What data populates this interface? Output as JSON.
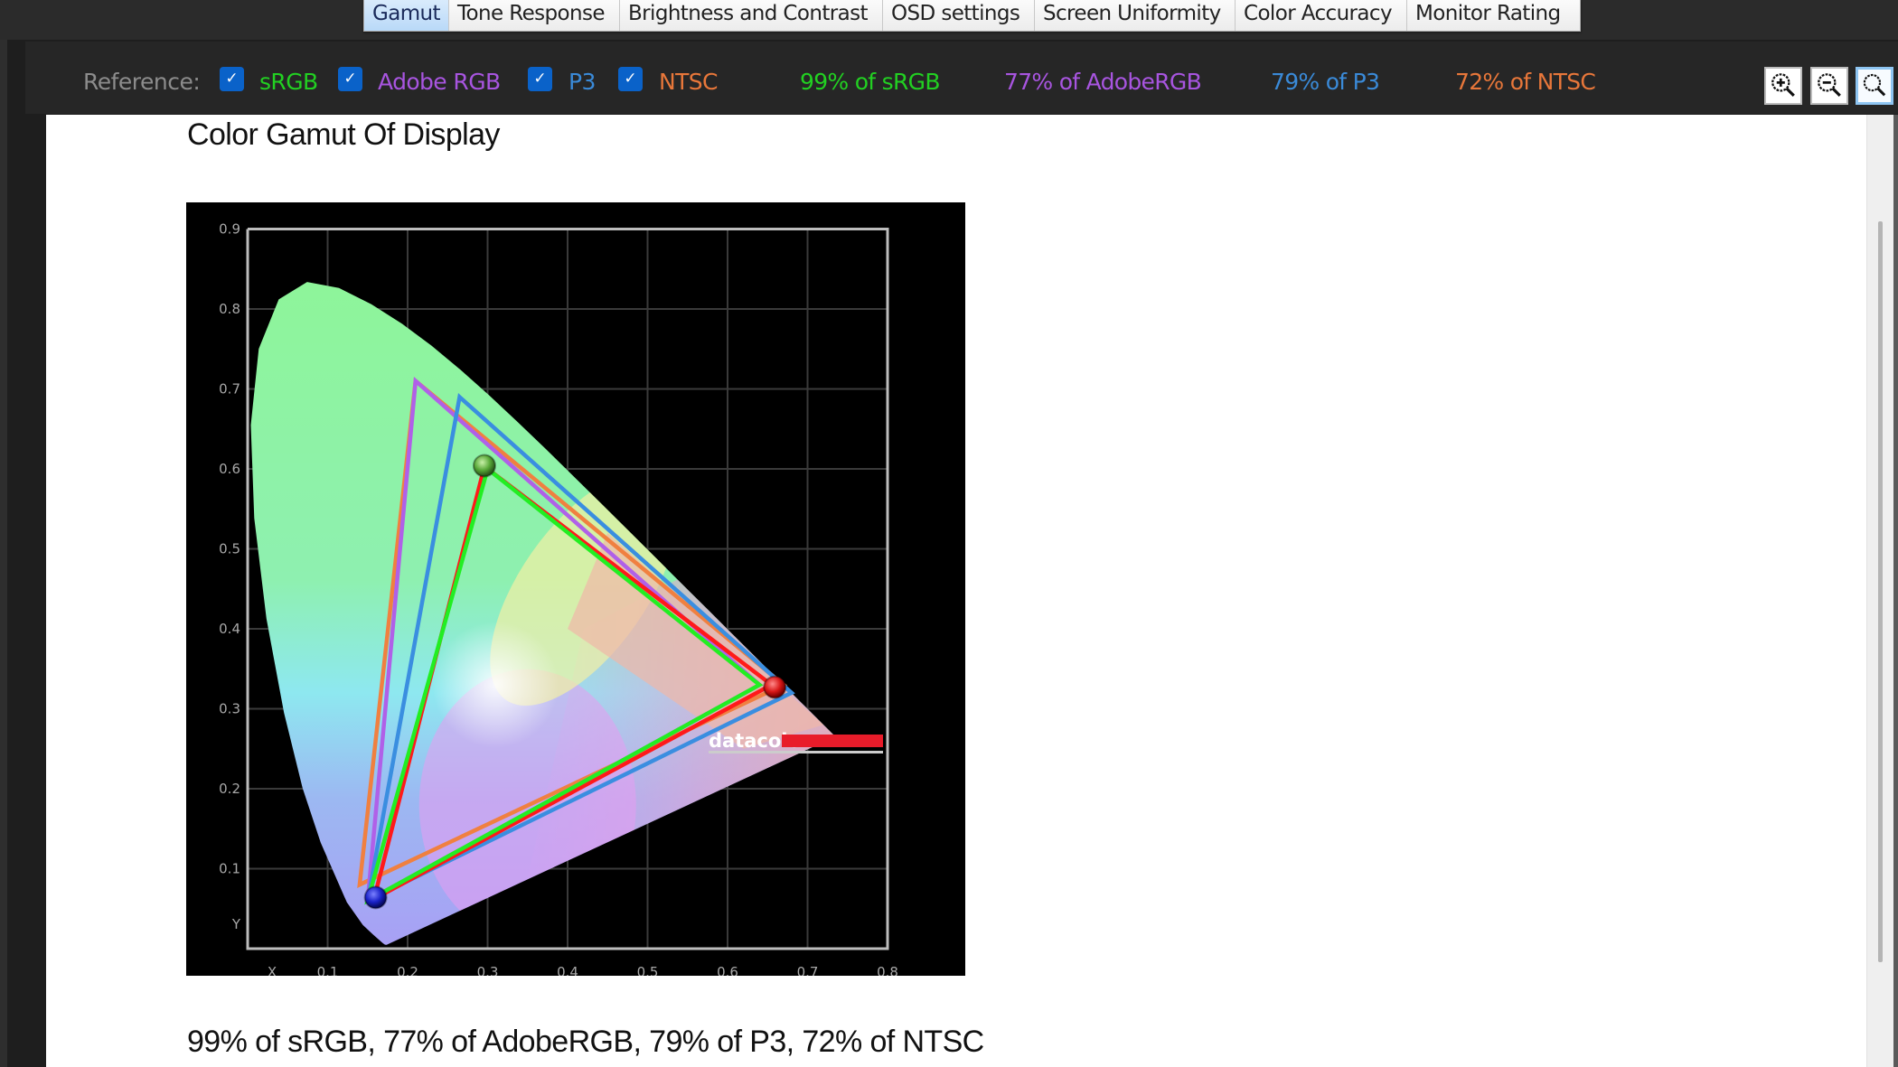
{
  "tabs": [
    {
      "label": "Gamut",
      "active": true
    },
    {
      "label": "Tone Response",
      "active": false
    },
    {
      "label": "Brightness and Contrast",
      "active": false
    },
    {
      "label": "OSD settings",
      "active": false
    },
    {
      "label": "Screen Uniformity",
      "active": false
    },
    {
      "label": "Color Accuracy",
      "active": false
    },
    {
      "label": "Monitor Rating",
      "active": false
    }
  ],
  "toolbar": {
    "reference_label": "Reference:",
    "references": [
      {
        "label": "sRGB",
        "checked": true,
        "color": "#22d022"
      },
      {
        "label": "Adobe RGB",
        "checked": true,
        "color": "#a855e0"
      },
      {
        "label": "P3",
        "checked": true,
        "color": "#3a8ad8"
      },
      {
        "label": "NTSC",
        "checked": true,
        "color": "#e8773a"
      }
    ],
    "checkmark": "✓",
    "coverage": [
      {
        "text": "99% of sRGB",
        "color": "#22d022"
      },
      {
        "text": "77% of AdobeRGB",
        "color": "#a855e0"
      },
      {
        "text": "79% of P3",
        "color": "#3a8ad8"
      },
      {
        "text": "72% of NTSC",
        "color": "#e8773a"
      }
    ],
    "zoom_buttons": [
      {
        "icon": "zoom-in-icon"
      },
      {
        "icon": "zoom-out-icon"
      },
      {
        "icon": "zoom-reset-icon",
        "active": true
      }
    ]
  },
  "content": {
    "title": "Color Gamut Of Display",
    "caption": "99% of sRGB, 77% of AdobeRGB, 79% of P3, 72% of NTSC"
  },
  "chart_data": {
    "type": "scatter",
    "title": "",
    "xlabel": "X",
    "ylabel": "Y",
    "xlim": [
      0,
      0.8
    ],
    "ylim": [
      0,
      0.9
    ],
    "xticks": [
      "0.1",
      "0.2",
      "0.3",
      "0.4",
      "0.5",
      "0.6",
      "0.7",
      "0.8"
    ],
    "yticks": [
      "0.1",
      "0.2",
      "0.3",
      "0.4",
      "0.5",
      "0.6",
      "0.7",
      "0.8",
      "0.9"
    ],
    "grid": true,
    "logo": "datacolor",
    "logo_bar_color": "#e81c2a",
    "series": [
      {
        "name": "NTSC",
        "color": "#f08040",
        "points": [
          [
            0.67,
            0.33
          ],
          [
            0.21,
            0.71
          ],
          [
            0.14,
            0.08
          ]
        ]
      },
      {
        "name": "Adobe RGB",
        "color": "#b060e8",
        "points": [
          [
            0.64,
            0.33
          ],
          [
            0.21,
            0.71
          ],
          [
            0.15,
            0.06
          ]
        ]
      },
      {
        "name": "P3",
        "color": "#3a8ee0",
        "points": [
          [
            0.68,
            0.32
          ],
          [
            0.265,
            0.69
          ],
          [
            0.15,
            0.06
          ]
        ]
      },
      {
        "name": "Display",
        "color": "#ff1a1a",
        "points": [
          [
            0.655,
            0.33
          ],
          [
            0.296,
            0.603
          ],
          [
            0.158,
            0.062
          ]
        ]
      },
      {
        "name": "sRGB",
        "color": "#22ee22",
        "points": [
          [
            0.64,
            0.33
          ],
          [
            0.3,
            0.6
          ],
          [
            0.15,
            0.06
          ]
        ]
      }
    ],
    "primaries": [
      {
        "name": "red",
        "x": 0.659,
        "y": 0.327,
        "color": "#e02020"
      },
      {
        "name": "green",
        "x": 0.296,
        "y": 0.604,
        "color": "#5fbf3a"
      },
      {
        "name": "blue",
        "x": 0.16,
        "y": 0.064,
        "color": "#1a22c8"
      }
    ]
  }
}
